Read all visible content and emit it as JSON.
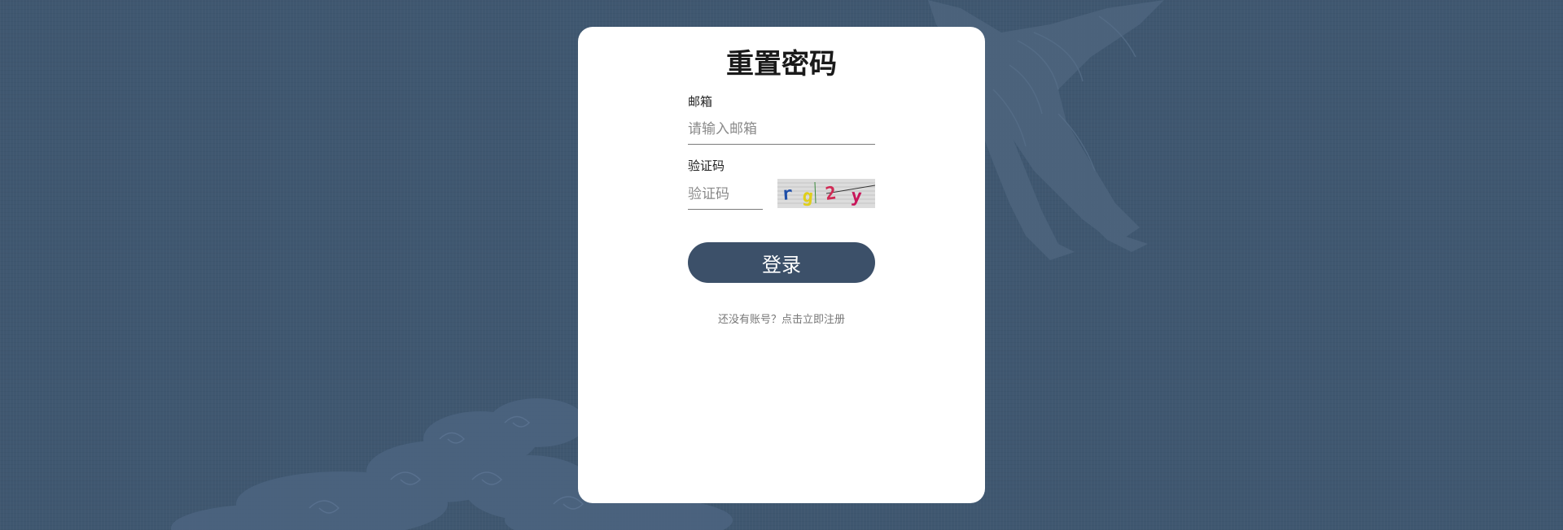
{
  "page": {
    "title": "重置密码",
    "background_color": "#3f5770",
    "card_color": "#ffffff",
    "accent_color": "#3c5069"
  },
  "form": {
    "email_label": "邮箱",
    "email_placeholder": "请输入邮箱",
    "email_value": "",
    "captcha_label": "验证码",
    "captcha_placeholder": "验证码",
    "captcha_value": "",
    "captcha_image_text": [
      "r",
      "g",
      "2",
      "y"
    ],
    "captcha_char_colors": [
      "#1f4fa8",
      "#e0cf1a",
      "#d02a55",
      "#c8165a"
    ],
    "submit_label": "登录",
    "register_text": "还没有账号？点击立即注册"
  },
  "icons": {
    "background_decor": "crane-and-clouds-pattern"
  }
}
